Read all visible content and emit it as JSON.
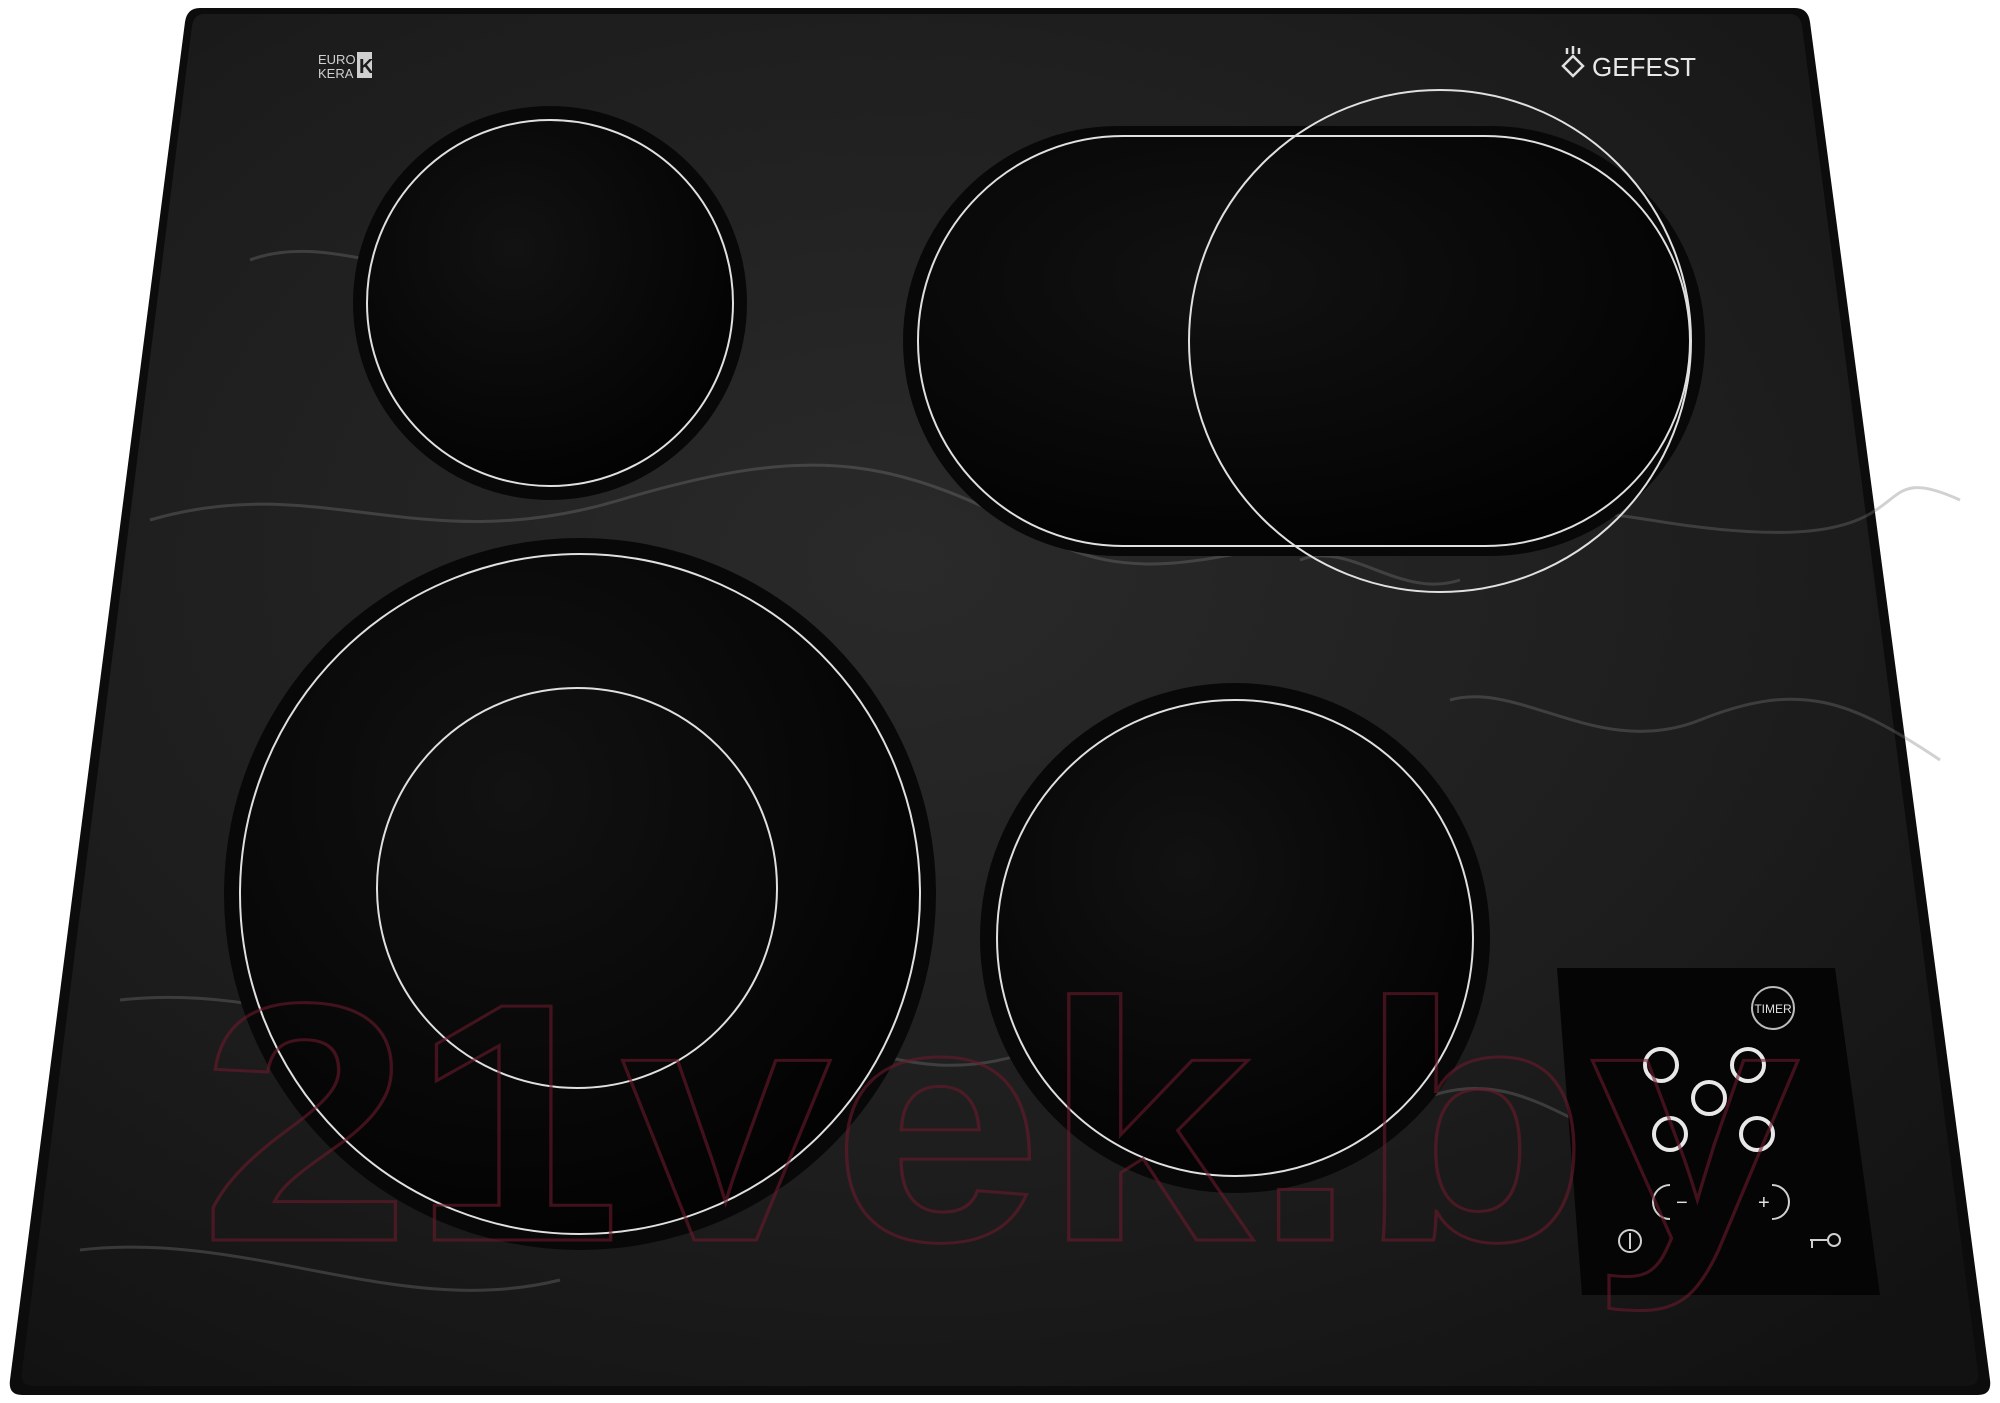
{
  "product": {
    "brand": "GEFEST",
    "certification_line1": "EURO",
    "certification_line2": "KERA",
    "certification_mark": "K"
  },
  "control_panel": {
    "timer_label": "TIMER",
    "minus_symbol": "−",
    "plus_symbol": "+"
  },
  "watermark": {
    "text": "21vek.by"
  },
  "colors": {
    "glass": "#1c1c1c",
    "zone": "#050505",
    "zone_outline": "#d8d8d8",
    "watermark": "#6b1a2c"
  },
  "icons": {
    "power": "power-icon",
    "lock": "key-lock-icon",
    "zone_selectors": [
      "zone-front-left-icon",
      "zone-rear-left-icon",
      "zone-rear-right-icon",
      "zone-front-right-icon"
    ]
  }
}
